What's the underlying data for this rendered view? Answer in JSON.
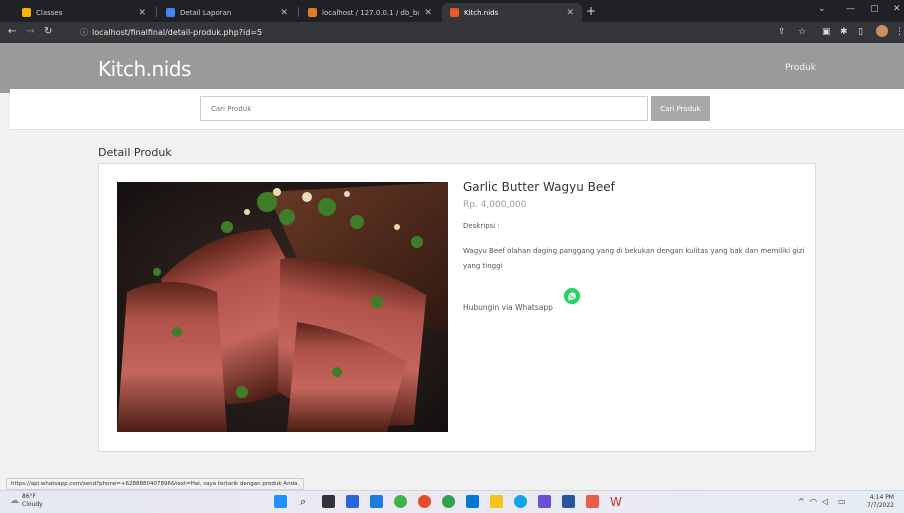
{
  "browser": {
    "tabs": [
      {
        "title": "Classes",
        "active": false
      },
      {
        "title": "Detail Laporan",
        "active": false
      },
      {
        "title": "localhost / 127.0.0.1 / db_bukaw...",
        "active": false
      },
      {
        "title": "Kitch.nids",
        "active": true
      }
    ],
    "url": "localhost/finalfinal/detail-produk.php?id=5"
  },
  "site": {
    "brand": "Kitch.nids",
    "nav_produk": "Produk",
    "search_placeholder": "Cari Produk",
    "search_button": "Cari Produk",
    "section_title": "Detail Produk"
  },
  "product": {
    "name": "Garlic Butter Wagyu Beef",
    "price": "Rp. 4,000,000",
    "description_label": "Deskripsi :",
    "description": "Wagyu Beef olahan daging panggang yang di bekukan dengan kulitas yang bak dan memiliki gizi yang tinggi",
    "contact_link": "Hubungin via Whatsapp"
  },
  "status_url": "https://api.whatsapp.com/send?phone=+6288880407896&text=Hai, saya tertarik dengan produk Anda.",
  "taskbar": {
    "weather_temp": "86°F",
    "weather_desc": "Cloudy",
    "time": "4:14 PM",
    "date": "7/7/2022"
  },
  "colors": {
    "navbar": "#9a9a9a",
    "whatsapp": "#25d366",
    "chrome_dark": "#202124"
  }
}
